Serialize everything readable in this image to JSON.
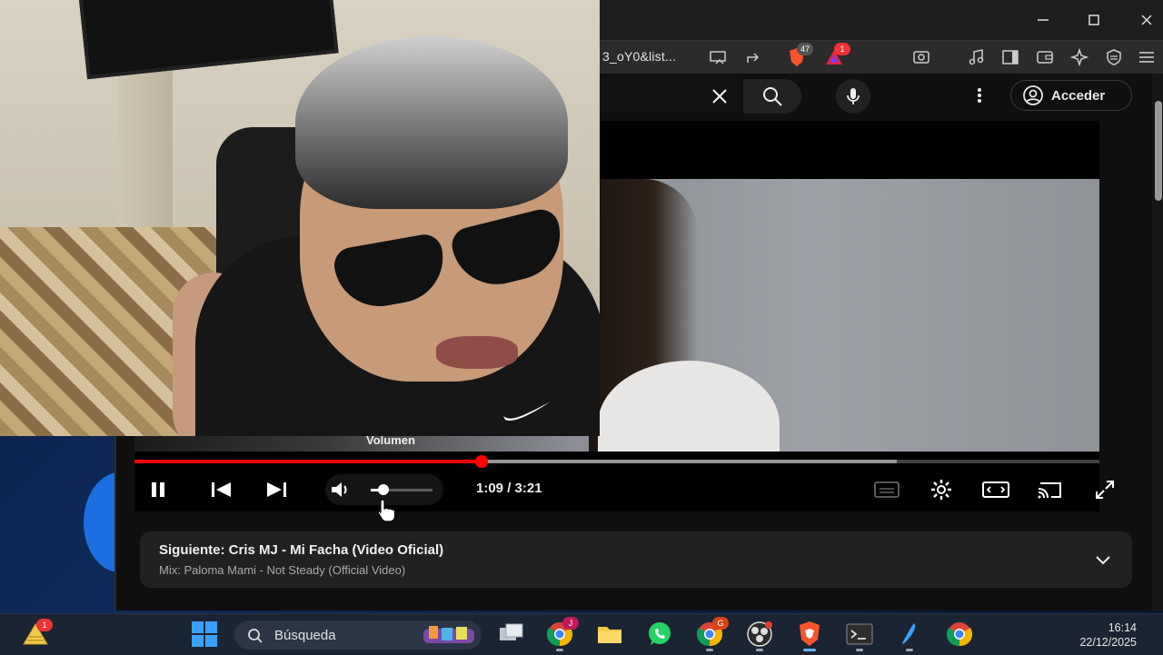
{
  "browser": {
    "url_fragment": "3_oY0&list...",
    "shields_count": "47",
    "rewards_count": "1",
    "window_controls": {
      "minimize": "minimize-icon",
      "maximize": "maximize-icon",
      "close": "close-icon"
    }
  },
  "youtube": {
    "signin_label": "Acceder",
    "player": {
      "volume_tooltip": "Volumen",
      "time_display": "1:09 / 3:21",
      "played_fraction": 0.36,
      "loaded_fraction": 0.79,
      "volume_fraction": 0.2
    },
    "up_next": {
      "title": "Siguiente: Cris MJ - Mi Facha (Video Oficial)",
      "subtitle": "Mix: Paloma Mami - Not Steady (Official Video)"
    }
  },
  "taskbar": {
    "search_placeholder": "Búsqueda",
    "widgets_badge": "1",
    "chrome_badge_1": "J",
    "chrome_badge_2": "G",
    "clock_time": "16:14",
    "clock_date": "22/12/2025"
  },
  "colors": {
    "yt_red": "#ff0000",
    "taskbar_bg": "#1b2433",
    "brave_orange": "#fb542b"
  }
}
